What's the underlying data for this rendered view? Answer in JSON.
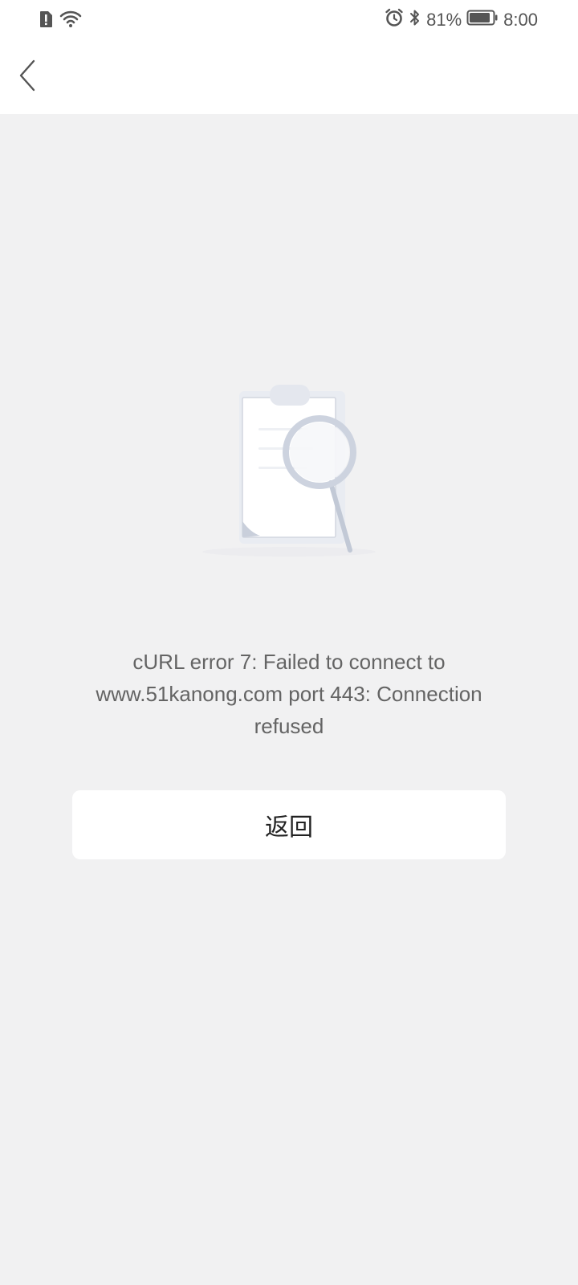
{
  "status_bar": {
    "battery_percent": "81%",
    "time": "8:00",
    "icons": [
      "sim-alert-icon",
      "wifi-icon",
      "alarm-icon",
      "bluetooth-icon",
      "battery-icon"
    ]
  },
  "nav": {
    "back_icon": "chevron-left-icon"
  },
  "error": {
    "illustration": "clipboard-magnifier-icon",
    "message": "cURL error 7: Failed to connect to www.51kanong.com port 443: Connection refused"
  },
  "actions": {
    "back_label": "返回"
  }
}
